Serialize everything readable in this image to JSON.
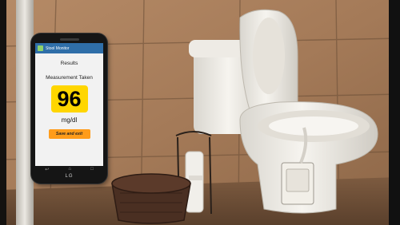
{
  "phone": {
    "app_title": "Stool Monitor",
    "results_label": "Results",
    "measurement_label": "Measurement Taken",
    "value": "96",
    "unit": "mg/dl",
    "save_button_label": "Save and exit",
    "brand": "LG"
  },
  "icons": [
    "app-icon",
    "back-icon",
    "home-icon",
    "recent-apps-icon"
  ],
  "colors": {
    "value_highlight": "#ffd600",
    "save_button": "#ff9c1a",
    "app_bar": "#2f6ea8"
  }
}
